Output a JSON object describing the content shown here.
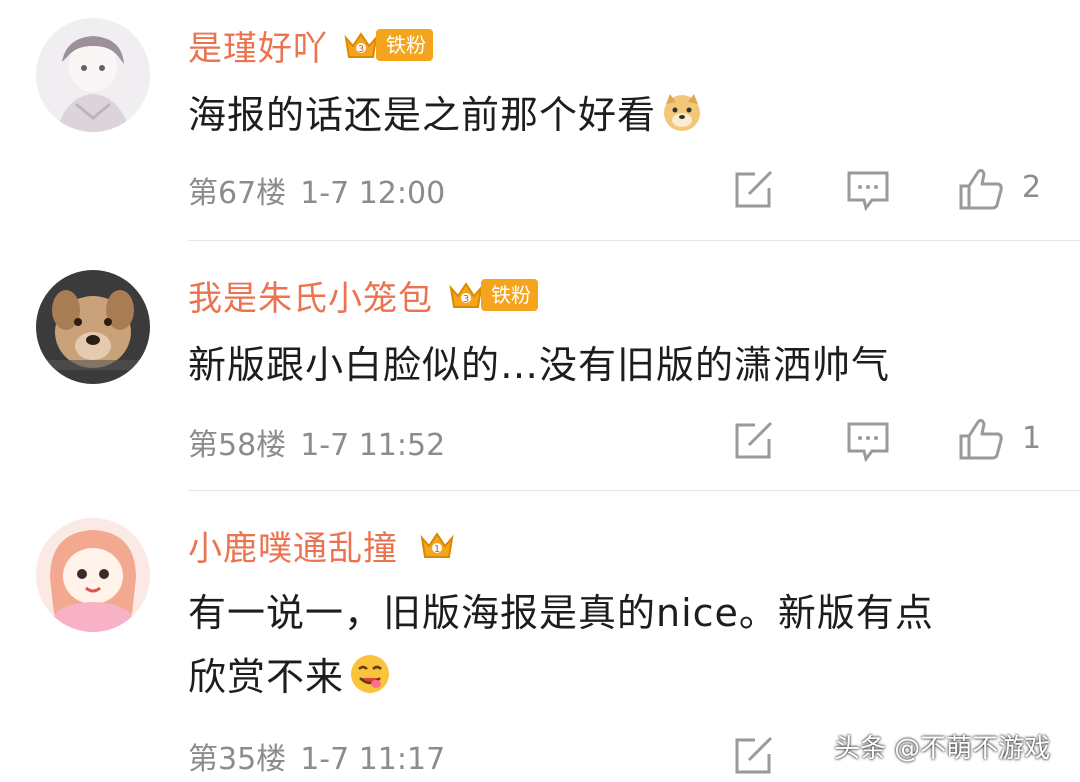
{
  "comments": [
    {
      "username": "是瑾好吖",
      "badge": "铁粉",
      "text": "海报的话还是之前那个好看",
      "emoji": "doge-emoji",
      "floor": "第67楼",
      "time": "1-7 12:00",
      "likes": "2"
    },
    {
      "username": "我是朱氏小笼包",
      "badge": "铁粉",
      "text": "新版跟小白脸似的…没有旧版的潇洒帅气",
      "floor": "第58楼",
      "time": "1-7 11:52",
      "likes": "1"
    },
    {
      "username": "小鹿噗通乱撞",
      "text_line1": "有一说一，旧版海报是真的nice。新版有点",
      "text_line2": "欣赏不来",
      "emoji": "yummy-emoji",
      "floor": "第35楼",
      "time": "1-7 11:17"
    }
  ],
  "watermark": "头条 @不萌不游戏",
  "colors": {
    "username": "#eb7350",
    "badge": "#f4a41d",
    "meta": "#8c8c8c",
    "icon": "#9a9a9a"
  },
  "icons": [
    "edit-icon",
    "comment-icon",
    "like-icon",
    "crown-icon"
  ]
}
